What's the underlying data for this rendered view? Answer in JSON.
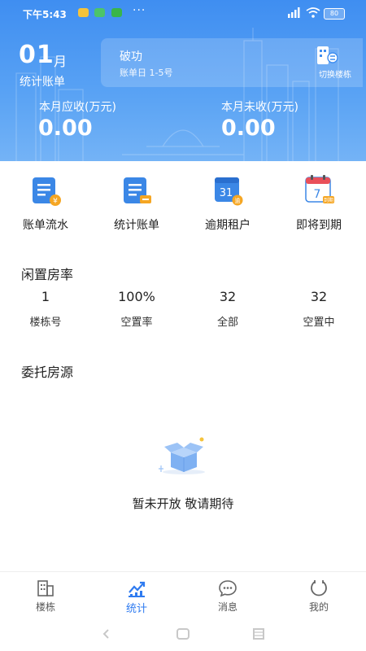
{
  "status_bar": {
    "time": "下午5:43",
    "more": "···",
    "battery": "80"
  },
  "header": {
    "month_number": "01",
    "month_unit": "月",
    "title": "统计账单",
    "building_name": "破功",
    "bill_day": "账单日 1-5号",
    "switch_label": "切换楼栋",
    "receivable_label": "本月应收(万元)",
    "receivable_value": "0.00",
    "unreceived_label": "本月未收(万元)",
    "unreceived_value": "0.00"
  },
  "menu": [
    {
      "label": "账单流水",
      "icon": "bill-flow-icon"
    },
    {
      "label": "统计账单",
      "icon": "stat-bill-icon"
    },
    {
      "label": "逾期租户",
      "icon": "overdue-calendar-icon",
      "badge_number": "31"
    },
    {
      "label": "即将到期",
      "icon": "expiring-calendar-icon",
      "badge_number": "7",
      "badge_text": "到期"
    }
  ],
  "vacancy": {
    "title": "闲置房率",
    "stats": [
      {
        "value": "1",
        "label": "楼栋号"
      },
      {
        "value": "100%",
        "label": "空置率"
      },
      {
        "value": "32",
        "label": "全部"
      },
      {
        "value": "32",
        "label": "空置中"
      }
    ]
  },
  "entrusted": {
    "title": "委托房源",
    "empty_text": "暂未开放 敬请期待"
  },
  "bottom_nav": [
    {
      "label": "楼栋",
      "icon": "building-icon",
      "active": false
    },
    {
      "label": "统计",
      "icon": "chart-icon",
      "active": true
    },
    {
      "label": "消息",
      "icon": "message-icon",
      "active": false
    },
    {
      "label": "我的",
      "icon": "profile-icon",
      "active": false
    }
  ],
  "colors": {
    "primary": "#3f8ef1",
    "active_tab": "#2f7bf0",
    "accent_orange": "#f5a623"
  }
}
